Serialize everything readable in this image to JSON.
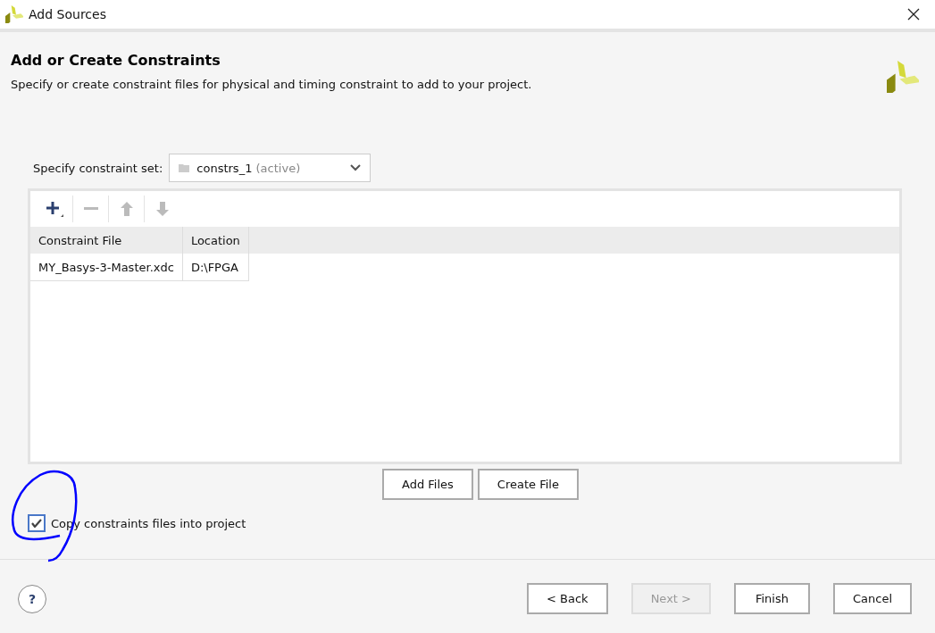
{
  "window": {
    "title": "Add Sources"
  },
  "header": {
    "title": "Add or Create Constraints",
    "subtitle": "Specify or create constraint files for physical and timing constraint to add to your project."
  },
  "constraint_set": {
    "label": "Specify constraint set:",
    "value": "constrs_1",
    "suffix": "(active)"
  },
  "toolbar": [
    {
      "kind": "add",
      "disabled": false
    },
    {
      "kind": "remove",
      "disabled": true
    },
    {
      "kind": "up",
      "disabled": true
    },
    {
      "kind": "down",
      "disabled": true
    }
  ],
  "table": {
    "columns": [
      "Constraint File",
      "Location"
    ],
    "rows": [
      [
        "MY_Basys-3-Master.xdc",
        "D:\\FPGA"
      ]
    ]
  },
  "file_buttons": [
    "Add Files",
    "Create File"
  ],
  "copy_option": {
    "label": "Copy constraints files into project",
    "checked": true
  },
  "annotation": {
    "kind": "circle",
    "color": "#0000ff"
  },
  "help": {
    "label": "?"
  },
  "footer_buttons": [
    {
      "label": "< Back",
      "disabled": false
    },
    {
      "label": "Next >",
      "disabled": true
    },
    {
      "label": "Finish",
      "disabled": false
    },
    {
      "label": "Cancel",
      "disabled": false
    }
  ]
}
